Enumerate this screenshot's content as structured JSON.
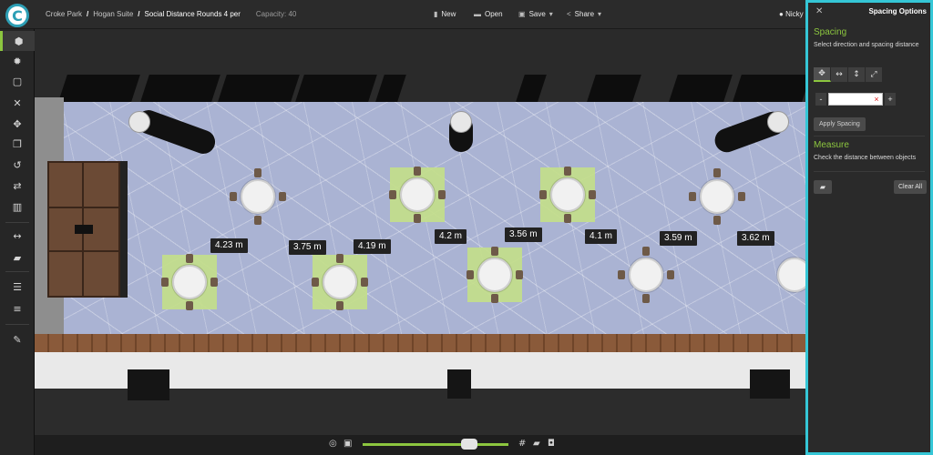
{
  "breadcrumb": {
    "venue": "Croke Park",
    "suite": "Hogan Suite",
    "layout": "Social Distance Rounds 4 per",
    "capacity": "Capacity: 40"
  },
  "menu": {
    "new": "New",
    "open": "Open",
    "save": "Save",
    "share": "Share"
  },
  "user": {
    "name": "Nicky"
  },
  "logo": {
    "letter": "C"
  },
  "measurements": [
    "4.23 m",
    "3.75 m",
    "4.19 m",
    "4.2 m",
    "3.56 m",
    "4.1 m",
    "3.59 m",
    "3.62 m"
  ],
  "panel": {
    "title": "Spacing Options",
    "spacing_title": "Spacing",
    "spacing_sub": "Select direction and spacing distance",
    "minus": "-",
    "plus": "+",
    "input_value": "",
    "clear_x": "×",
    "apply": "Apply Spacing",
    "measure_title": "Measure",
    "measure_sub": "Check the distance between objects",
    "clear_all": "Clear All"
  },
  "colors": {
    "accent": "#8cc63f",
    "panel_border": "#35c6d6",
    "floor": "#aab3d3",
    "mat": "#c3de8a"
  },
  "icons": {
    "toolbar": [
      "cube-icon",
      "sun-icon",
      "select-box-icon",
      "close-icon",
      "move-icon",
      "copy-icon",
      "rotate-icon",
      "swap-icon",
      "trash-icon",
      "distance-icon",
      "ruler-icon",
      "align-top-icon",
      "align-middle-icon",
      "edit-icon"
    ],
    "bottom": [
      "target-icon",
      "frame-icon",
      "grid-icon",
      "ruler-icon",
      "camera-icon"
    ],
    "direction": [
      "move-all-icon",
      "horizontal-icon",
      "vertical-icon",
      "diagonal-icon"
    ]
  },
  "zoom": {
    "level_fraction": 0.7
  }
}
